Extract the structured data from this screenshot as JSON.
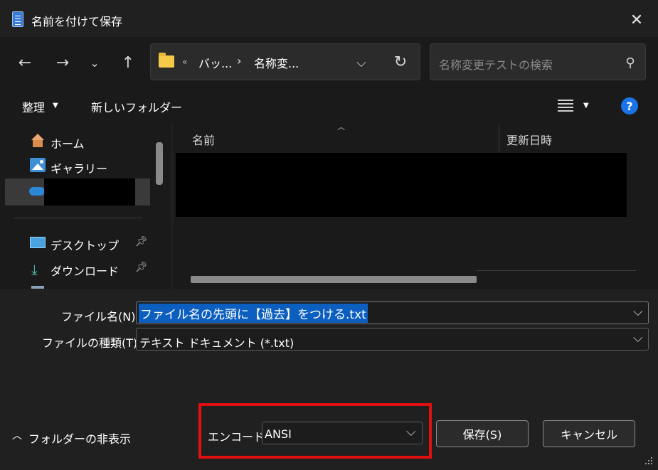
{
  "window": {
    "title": "名前を付けて保存"
  },
  "nav": {
    "address": {
      "ellipsis": "«",
      "crumb1": "バッ...",
      "crumb2": "名称変..."
    },
    "search_placeholder": "名称変更テストの検索"
  },
  "toolbar": {
    "organize": "整理",
    "new_folder": "新しいフォルダー"
  },
  "sidebar": {
    "items": [
      {
        "label": "ホーム",
        "icon": "home-icon"
      },
      {
        "label": "ギャラリー",
        "icon": "gallery-icon"
      },
      {
        "label": "",
        "icon": "onedrive-icon"
      },
      {
        "label": "デスクトップ",
        "icon": "desktop-icon",
        "pinned": true
      },
      {
        "label": "ダウンロード",
        "icon": "download-icon",
        "pinned": true
      }
    ]
  },
  "file_list": {
    "columns": [
      "名前",
      "更新日時"
    ]
  },
  "form": {
    "filename_label": "ファイル名(N):",
    "filename_value": "ファイル名の先頭に【過去】をつける.txt",
    "type_label": "ファイルの種類(T):",
    "type_value": "テキスト ドキュメント (*.txt)",
    "hide_folders": "フォルダーの非表示",
    "encoding_label": "エンコード:",
    "encoding_value": "ANSI",
    "save_button": "保存(S)",
    "cancel_button": "キャンセル"
  },
  "colors": {
    "highlight": "#e01010",
    "selection": "#0c5fbf",
    "help": "#1a73e8"
  }
}
